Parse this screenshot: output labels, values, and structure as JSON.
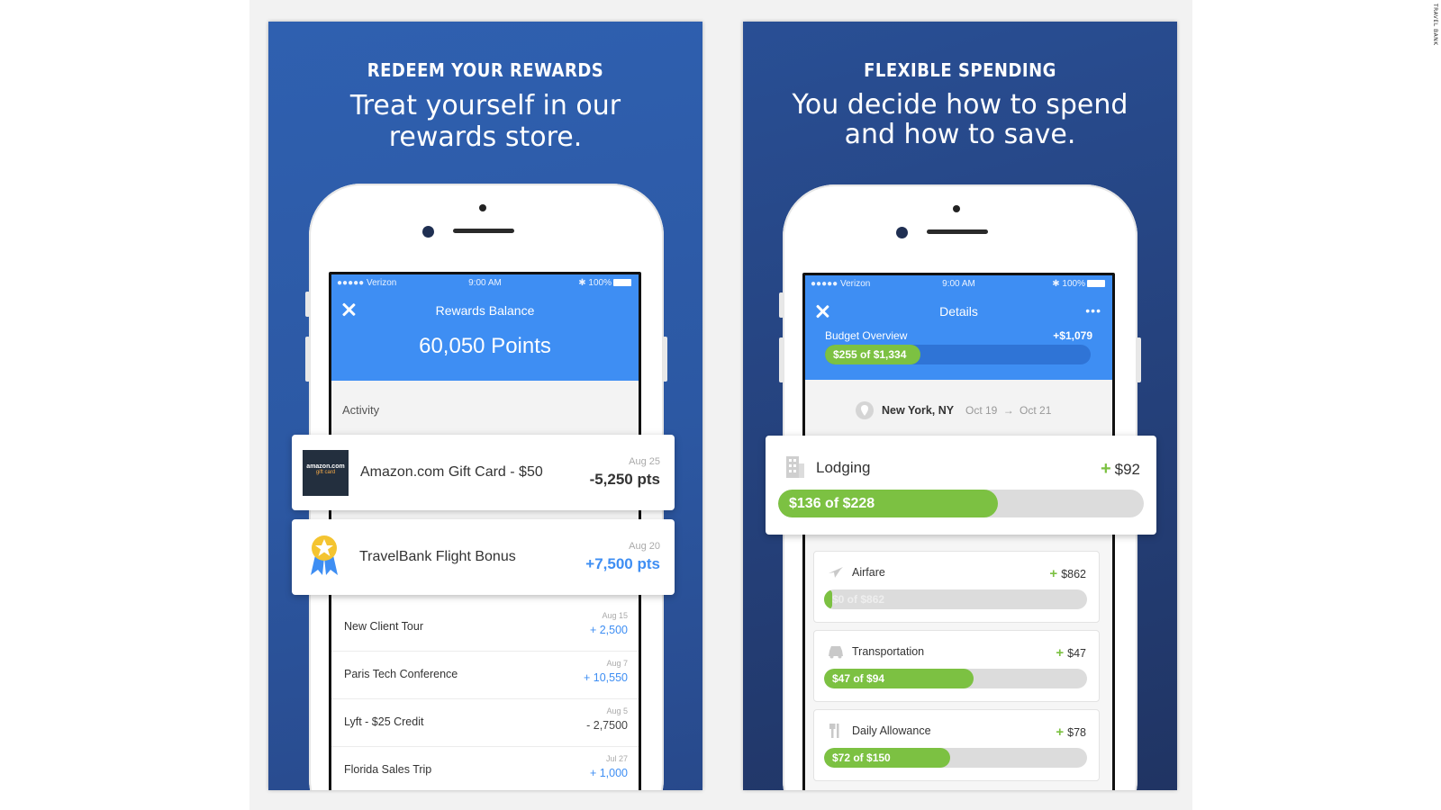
{
  "watermark": "TRAVEL BANK",
  "left_panel": {
    "kicker": "REDEEM YOUR REWARDS",
    "headline_line1": "Treat yourself in our",
    "headline_line2": "rewards store.",
    "status": {
      "carrier": "●●●●● Verizon",
      "time": "9:00 AM",
      "battery": "✱ 100%"
    },
    "header_title": "Rewards Balance",
    "points": "60,050 Points",
    "activity_label": "Activity",
    "highlight_cards": [
      {
        "logo_text": "amazon.com",
        "logo_sub": "gift card",
        "title": "Amazon.com Gift Card - $50",
        "date": "Aug 25",
        "amount": "-5,250 pts",
        "type": "negative"
      },
      {
        "title": "TravelBank Flight Bonus",
        "date": "Aug 20",
        "amount": "+7,500 pts",
        "type": "positive"
      }
    ],
    "activity_rows": [
      {
        "title": "New Client Tour",
        "date": "Aug 15",
        "amount": "+ 2,500",
        "type": "positive"
      },
      {
        "title": "Paris Tech Conference",
        "date": "Aug 7",
        "amount": "+ 10,550",
        "type": "positive"
      },
      {
        "title": "Lyft - $25 Credit",
        "date": "Aug 5",
        "amount": "- 2,7500",
        "type": "negative"
      },
      {
        "title": "Florida Sales Trip",
        "date": "Jul 27",
        "amount": "+ 1,000",
        "type": "positive"
      }
    ]
  },
  "right_panel": {
    "kicker": "FLEXIBLE SPENDING",
    "headline_line1": "You decide how to spend",
    "headline_line2": "and how to save.",
    "status": {
      "carrier": "●●●●● Verizon",
      "time": "9:00 AM",
      "battery": "✱ 100%"
    },
    "header_title": "Details",
    "more_label": "•••",
    "budget_label": "Budget Overview",
    "budget_plus": "+$1,079",
    "budget_bar": {
      "text": "$255 of $1,334",
      "fraction": 0.36
    },
    "trip": {
      "city": "New York, NY",
      "from": "Oct 19",
      "arrow": "→",
      "to": "Oct 21"
    },
    "lodging": {
      "label": "Lodging",
      "plus_sign": "+",
      "plus": "$92",
      "bar_text": "$136 of $228",
      "fraction": 0.6
    },
    "categories": [
      {
        "label": "Airfare",
        "icon": "airplane-icon",
        "plus_sign": "+",
        "plus": "$862",
        "bar_text": "$0 of $862",
        "fraction": 0.0
      },
      {
        "label": "Transportation",
        "icon": "car-icon",
        "plus_sign": "+",
        "plus": "$47",
        "bar_text": "$47 of $94",
        "fraction": 0.57
      },
      {
        "label": "Daily Allowance",
        "icon": "utensils-icon",
        "plus_sign": "+",
        "plus": "$78",
        "bar_text": "$72 of $150",
        "fraction": 0.48
      }
    ]
  },
  "colors": {
    "brand_blue": "#3e8ef3",
    "progress_green": "#7cc142",
    "track_gray": "#dcdcdc"
  }
}
